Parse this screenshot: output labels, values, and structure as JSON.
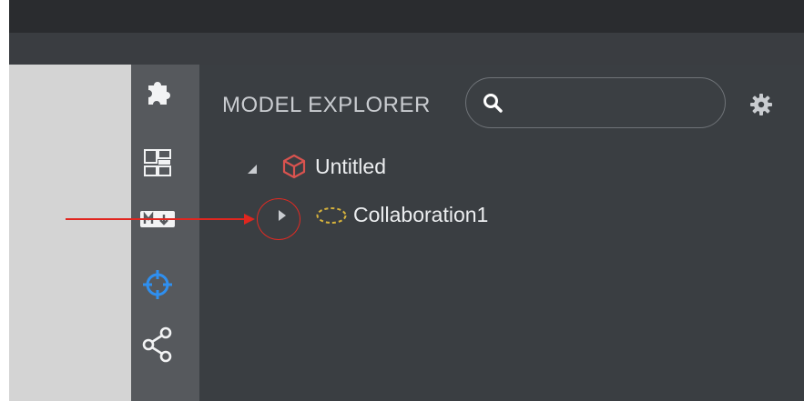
{
  "panel": {
    "title": "MODEL EXPLORER",
    "search": {
      "value": "",
      "placeholder": ""
    }
  },
  "toolbar": {
    "items": [
      {
        "icon": "puzzle-icon"
      },
      {
        "icon": "layout-grid-icon"
      },
      {
        "icon": "markdown-icon",
        "text": "M↓"
      },
      {
        "icon": "crosshair-icon",
        "active": true
      },
      {
        "icon": "share-icon"
      }
    ]
  },
  "tree": {
    "root": {
      "label": "Untitled",
      "expanded": true,
      "icon": "cube-icon"
    },
    "children": [
      {
        "label": "Collaboration1",
        "expanded": false,
        "icon": "collaboration-ellipse-icon"
      }
    ]
  },
  "colors": {
    "accent": "#2f8fef",
    "cube": "#d9534f",
    "collaboration": "#d7b33c",
    "annotation": "#e0261f"
  }
}
